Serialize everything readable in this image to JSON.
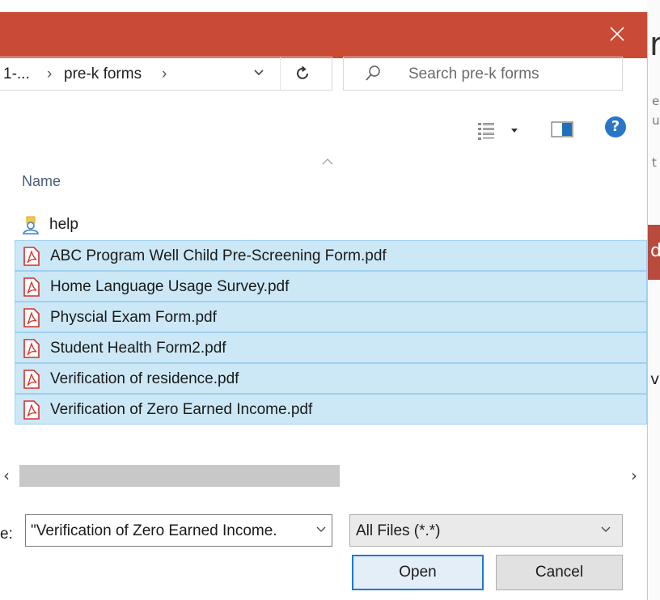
{
  "background": {
    "heading_fragment": "r",
    "side_fragments": [
      "e",
      "u",
      "t"
    ],
    "button_fragment": "d",
    "text_fragment": "vi"
  },
  "colors": {
    "titlebar": "#c94a35",
    "selection": "#cce8f6",
    "primary_border": "#1e78d7",
    "pdf_icon": "#d0312d",
    "folder": "#f3c64a"
  },
  "titlebar": {
    "close_icon": "close-icon"
  },
  "address_bar": {
    "crumbs": [
      {
        "label": "1-..."
      },
      {
        "label": "pre-k forms"
      }
    ],
    "separator": "›"
  },
  "search": {
    "placeholder": "Search pre-k forms"
  },
  "toolbar": {
    "help_label": "?"
  },
  "list": {
    "column_name": "Name",
    "items": [
      {
        "label": "help",
        "type": "folder",
        "selected": false
      },
      {
        "label": "ABC Program Well Child Pre-Screening Form.pdf",
        "type": "pdf",
        "selected": true
      },
      {
        "label": "Home Language Usage Survey.pdf",
        "type": "pdf",
        "selected": true
      },
      {
        "label": "Physcial Exam Form.pdf",
        "type": "pdf",
        "selected": true
      },
      {
        "label": "Student Health Form2.pdf",
        "type": "pdf",
        "selected": true
      },
      {
        "label": "Verification of residence.pdf",
        "type": "pdf",
        "selected": true
      },
      {
        "label": "Verification of Zero Earned Income.pdf",
        "type": "pdf",
        "selected": true
      }
    ]
  },
  "scrollbar": {
    "left_arrow": "‹",
    "right_arrow": "›"
  },
  "footer": {
    "filename_label": "e:",
    "filename_value": "\"Verification of Zero Earned Income.",
    "filetype_value": "All Files (*.*)",
    "open_label": "Open",
    "cancel_label": "Cancel"
  }
}
